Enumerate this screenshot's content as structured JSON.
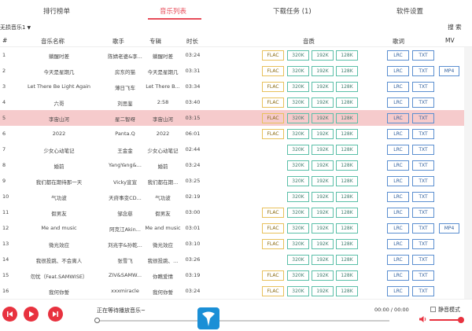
{
  "tabs": [
    {
      "label": "排行榜单",
      "active": false
    },
    {
      "label": "音乐列表",
      "active": true
    },
    {
      "label": "下载任务 (1)",
      "active": false
    },
    {
      "label": "软件设置",
      "active": false
    }
  ],
  "toolbar": {
    "quality_select_value": "无损音乐1",
    "search_label": "搜 索"
  },
  "table": {
    "headers": {
      "no": "#",
      "name": "音乐名称",
      "artist": "歌手",
      "album": "专辑",
      "duration": "时长",
      "quality": "音质",
      "lyrics": "歌词",
      "mv": "MV"
    },
    "buttons": {
      "flac": "FLAC",
      "q320": "320K",
      "q192": "192K",
      "q128": "128K",
      "lrc": "LRC",
      "txt": "TXT",
      "mv": "MP4"
    },
    "rows": [
      {
        "no": "1",
        "name": "躺醒时差",
        "artist": "陈婧老婆&李...",
        "album": "躺醒时差",
        "duration": "03:24",
        "flac": true,
        "mv": false,
        "highlight": false
      },
      {
        "no": "2",
        "name": "今天是星期几",
        "artist": "房东的猫",
        "album": "今天是星期几",
        "duration": "03:31",
        "flac": true,
        "mv": true,
        "highlight": false
      },
      {
        "no": "3",
        "name": "Let There Be Light Again",
        "artist": "薄日飞车",
        "album": "Let There B...",
        "duration": "03:34",
        "flac": true,
        "mv": false,
        "highlight": false
      },
      {
        "no": "4",
        "name": "六哥",
        "artist": "刘思鉴",
        "album": "2:58",
        "duration": "03:40",
        "flac": true,
        "mv": false,
        "highlight": false
      },
      {
        "no": "5",
        "name": "李宙山河",
        "artist": "星二智呀",
        "album": "李宙山河",
        "duration": "03:15",
        "flac": true,
        "mv": false,
        "highlight": true
      },
      {
        "no": "6",
        "name": "2022",
        "artist": "Panta.Q",
        "album": "2022",
        "duration": "06:01",
        "flac": true,
        "mv": false,
        "highlight": false
      },
      {
        "no": "7",
        "name": "少女心动笔记",
        "artist": "王金金",
        "album": "少女心动笔记",
        "duration": "02:44",
        "flac": false,
        "mv": false,
        "highlight": false
      },
      {
        "no": "8",
        "name": "婚前",
        "artist": "YangYang&...",
        "album": "婚前",
        "duration": "03:24",
        "flac": false,
        "mv": false,
        "highlight": false
      },
      {
        "no": "9",
        "name": "我们都在期待那一天",
        "artist": "Vicky宣宣",
        "album": "我们都在期...",
        "duration": "03:25",
        "flac": false,
        "mv": false,
        "highlight": false
      },
      {
        "no": "10",
        "name": "气功波",
        "artist": "天府事变CD...",
        "album": "气功波",
        "duration": "02:19",
        "flac": false,
        "mv": false,
        "highlight": false
      },
      {
        "no": "11",
        "name": "假男友",
        "artist": "邹念慈",
        "album": "假男友",
        "duration": "03:00",
        "flac": true,
        "mv": false,
        "highlight": false
      },
      {
        "no": "12",
        "name": "Me and music",
        "artist": "阿克江Akin...",
        "album": "Me and music",
        "duration": "03:01",
        "flac": true,
        "mv": true,
        "highlight": false
      },
      {
        "no": "13",
        "name": "微光效应",
        "artist": "刘兆宇&孙乾...",
        "album": "微光效应",
        "duration": "03:10",
        "flac": true,
        "mv": false,
        "highlight": false
      },
      {
        "no": "14",
        "name": "我很投跳、不会离人",
        "artist": "张雪飞",
        "album": "我很投跳、...",
        "duration": "03:26",
        "flac": false,
        "mv": false,
        "highlight": false
      },
      {
        "no": "15",
        "name": "勿忧（Feat.SAMWISE）",
        "artist": "ZIV&SAMW...",
        "album": "你瞧爱情",
        "duration": "03:19",
        "flac": true,
        "mv": false,
        "highlight": false
      },
      {
        "no": "16",
        "name": "我何你誓",
        "artist": "xxxmiracle",
        "album": "我何你誓",
        "duration": "03:24",
        "flac": true,
        "mv": false,
        "highlight": false
      }
    ]
  },
  "player": {
    "now_playing": "正在等待播放音乐~",
    "time": "00:00 / 00:00",
    "mute_label": "静音模式",
    "accent": "#e8323f",
    "volume_fraction": 0.9
  },
  "watermark_logo": "xue-logo"
}
